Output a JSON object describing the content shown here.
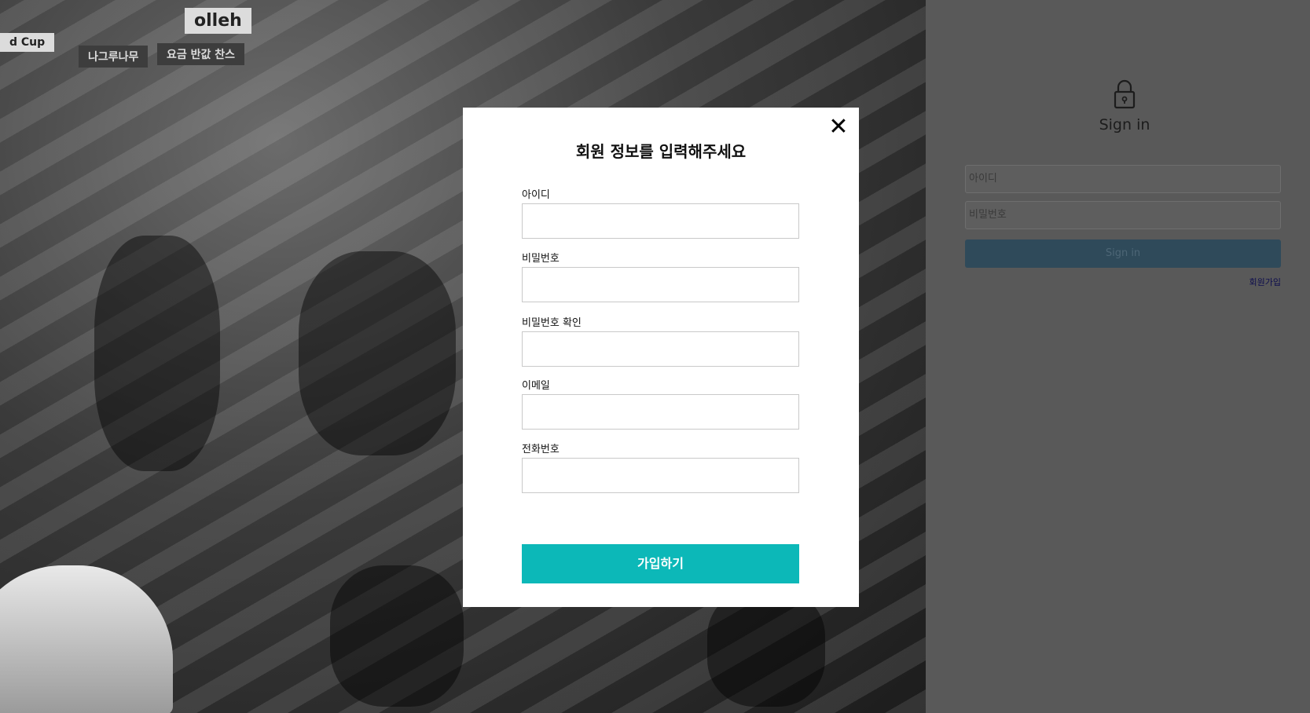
{
  "background": {
    "signs": [
      "olleh",
      "d Cup",
      "나그루나무",
      "요금 반값 찬스"
    ]
  },
  "login_panel": {
    "title": "Sign in",
    "id_placeholder": "아이디",
    "password_placeholder": "비밀번호",
    "signin_button": "Sign in",
    "signup_link": "회원가입"
  },
  "modal": {
    "title": "회원 정보를 입력해주세요",
    "close_symbol": "✕",
    "fields": [
      {
        "label": "아이디",
        "value": ""
      },
      {
        "label": "비밀번호",
        "value": ""
      },
      {
        "label": "비밀번호 확인",
        "value": ""
      },
      {
        "label": "이메일",
        "value": ""
      },
      {
        "label": "전화번호",
        "value": ""
      }
    ],
    "submit_label": "가입하기"
  },
  "colors": {
    "accent": "#0cb8b8",
    "overlay": "#595959",
    "signin_button": "#2f4a5a"
  }
}
